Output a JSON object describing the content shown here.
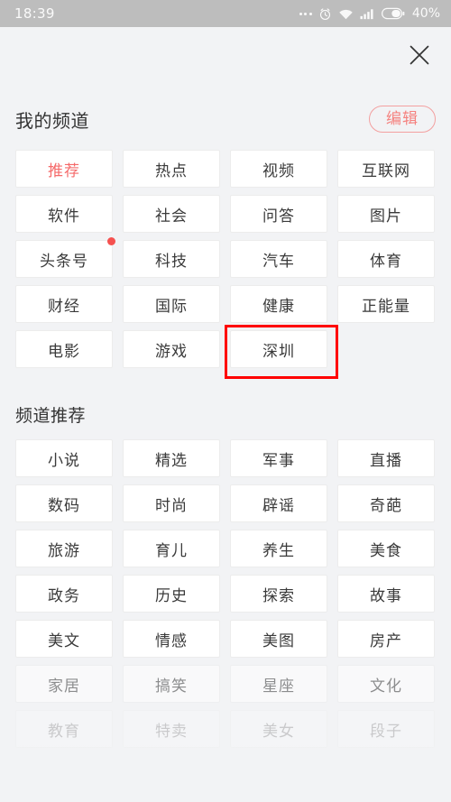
{
  "status_bar": {
    "time": "18:39",
    "battery_text": "40%",
    "icons": [
      "more-dots-icon",
      "alarm-clock-icon",
      "wifi-icon",
      "signal-bars-icon",
      "battery-icon"
    ]
  },
  "header": {
    "close_icon": "close-icon"
  },
  "my_channels": {
    "title": "我的频道",
    "edit_label": "编辑",
    "tiles": [
      {
        "label": "推荐",
        "state": "active"
      },
      {
        "label": "热点",
        "state": "normal"
      },
      {
        "label": "视频",
        "state": "normal"
      },
      {
        "label": "互联网",
        "state": "normal"
      },
      {
        "label": "软件",
        "state": "normal"
      },
      {
        "label": "社会",
        "state": "normal"
      },
      {
        "label": "问答",
        "state": "normal"
      },
      {
        "label": "图片",
        "state": "normal"
      },
      {
        "label": "头条号",
        "state": "normal",
        "badge": true
      },
      {
        "label": "科技",
        "state": "normal"
      },
      {
        "label": "汽车",
        "state": "normal"
      },
      {
        "label": "体育",
        "state": "normal"
      },
      {
        "label": "财经",
        "state": "normal"
      },
      {
        "label": "国际",
        "state": "normal"
      },
      {
        "label": "健康",
        "state": "normal"
      },
      {
        "label": "正能量",
        "state": "normal"
      },
      {
        "label": "电影",
        "state": "normal"
      },
      {
        "label": "游戏",
        "state": "normal"
      },
      {
        "label": "深圳",
        "state": "normal",
        "highlighted": true
      }
    ]
  },
  "recommended_channels": {
    "title": "频道推荐",
    "tiles": [
      {
        "label": "小说",
        "fade": 0
      },
      {
        "label": "精选",
        "fade": 0
      },
      {
        "label": "军事",
        "fade": 0
      },
      {
        "label": "直播",
        "fade": 0
      },
      {
        "label": "数码",
        "fade": 0
      },
      {
        "label": "时尚",
        "fade": 0
      },
      {
        "label": "辟谣",
        "fade": 0
      },
      {
        "label": "奇葩",
        "fade": 0
      },
      {
        "label": "旅游",
        "fade": 0
      },
      {
        "label": "育儿",
        "fade": 0
      },
      {
        "label": "养生",
        "fade": 0
      },
      {
        "label": "美食",
        "fade": 0
      },
      {
        "label": "政务",
        "fade": 0
      },
      {
        "label": "历史",
        "fade": 0
      },
      {
        "label": "探索",
        "fade": 0
      },
      {
        "label": "故事",
        "fade": 0
      },
      {
        "label": "美文",
        "fade": 0
      },
      {
        "label": "情感",
        "fade": 0
      },
      {
        "label": "美图",
        "fade": 0
      },
      {
        "label": "房产",
        "fade": 0
      },
      {
        "label": "家居",
        "fade": 1
      },
      {
        "label": "搞笑",
        "fade": 1
      },
      {
        "label": "星座",
        "fade": 1
      },
      {
        "label": "文化",
        "fade": 1
      },
      {
        "label": "教育",
        "fade": 2
      },
      {
        "label": "特卖",
        "fade": 2
      },
      {
        "label": "美女",
        "fade": 2
      },
      {
        "label": "段子",
        "fade": 2
      }
    ]
  },
  "colors": {
    "page_background": "#f2f3f5",
    "status_bar": "#bdbdbd",
    "tile_background": "#ffffff",
    "accent_red": "#f56a6a",
    "edit_border": "#f3a0a0",
    "badge_red": "#f5514f",
    "annotation_red": "#ff0000",
    "text_primary": "#333333"
  }
}
